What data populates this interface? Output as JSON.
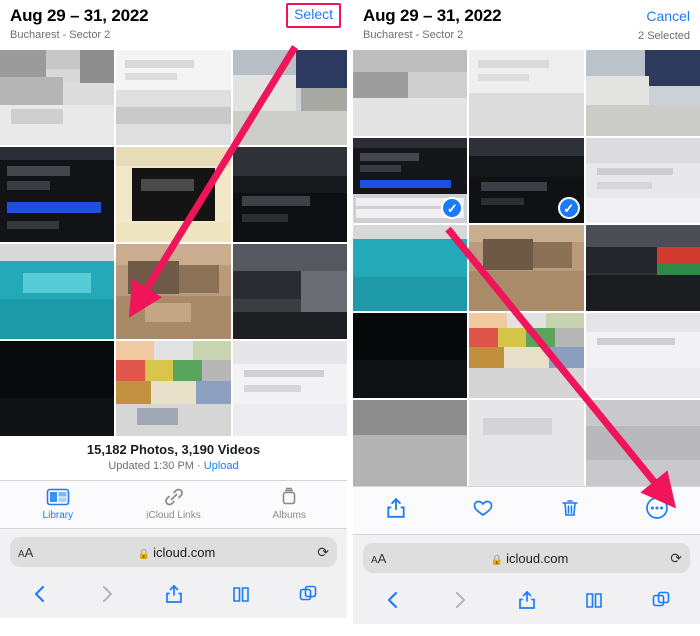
{
  "left": {
    "header": {
      "title": "Aug 29 – 31, 2022",
      "subtitle": "Bucharest - Sector 2",
      "action_label": "Select"
    },
    "stats": {
      "counts": "15,182 Photos, 3,190 Videos",
      "updated": "Updated 1:30 PM",
      "separator": "·",
      "upload_label": "Upload"
    },
    "tabs": [
      {
        "label": "Library",
        "icon": "photos-icon",
        "active": true
      },
      {
        "label": "iCloud Links",
        "icon": "link-icon",
        "active": false
      },
      {
        "label": "Albums",
        "icon": "albums-icon",
        "active": false
      }
    ],
    "browser": {
      "aa_label": "AA",
      "lock_icon": "lock-icon",
      "url": "icloud.com",
      "reload_icon": "reload-icon",
      "nav": [
        {
          "icon": "back-icon",
          "enabled": true
        },
        {
          "icon": "forward-icon",
          "enabled": false
        },
        {
          "icon": "share-icon",
          "enabled": true
        },
        {
          "icon": "bookmarks-icon",
          "enabled": true
        },
        {
          "icon": "tabs-icon",
          "enabled": true
        }
      ]
    }
  },
  "right": {
    "header": {
      "title": "Aug 29 – 31, 2022",
      "subtitle": "Bucharest - Sector 2",
      "action_label": "Cancel",
      "selection_status": "2 Selected"
    },
    "actions": [
      {
        "icon": "share-icon",
        "name": "share-button"
      },
      {
        "icon": "heart-icon",
        "name": "favorite-button"
      },
      {
        "icon": "trash-icon",
        "name": "delete-button"
      },
      {
        "icon": "more-icon",
        "name": "more-options-button"
      }
    ],
    "browser": {
      "aa_label": "AA",
      "lock_icon": "lock-icon",
      "url": "icloud.com",
      "reload_icon": "reload-icon",
      "nav": [
        {
          "icon": "back-icon",
          "enabled": true
        },
        {
          "icon": "forward-icon",
          "enabled": false
        },
        {
          "icon": "share-icon",
          "enabled": true
        },
        {
          "icon": "bookmarks-icon",
          "enabled": true
        },
        {
          "icon": "tabs-icon",
          "enabled": true
        }
      ]
    }
  },
  "annotations": {
    "accent_color": "#f0145a",
    "arrow1_target": "Select button",
    "arrow2_target": "More options button"
  }
}
